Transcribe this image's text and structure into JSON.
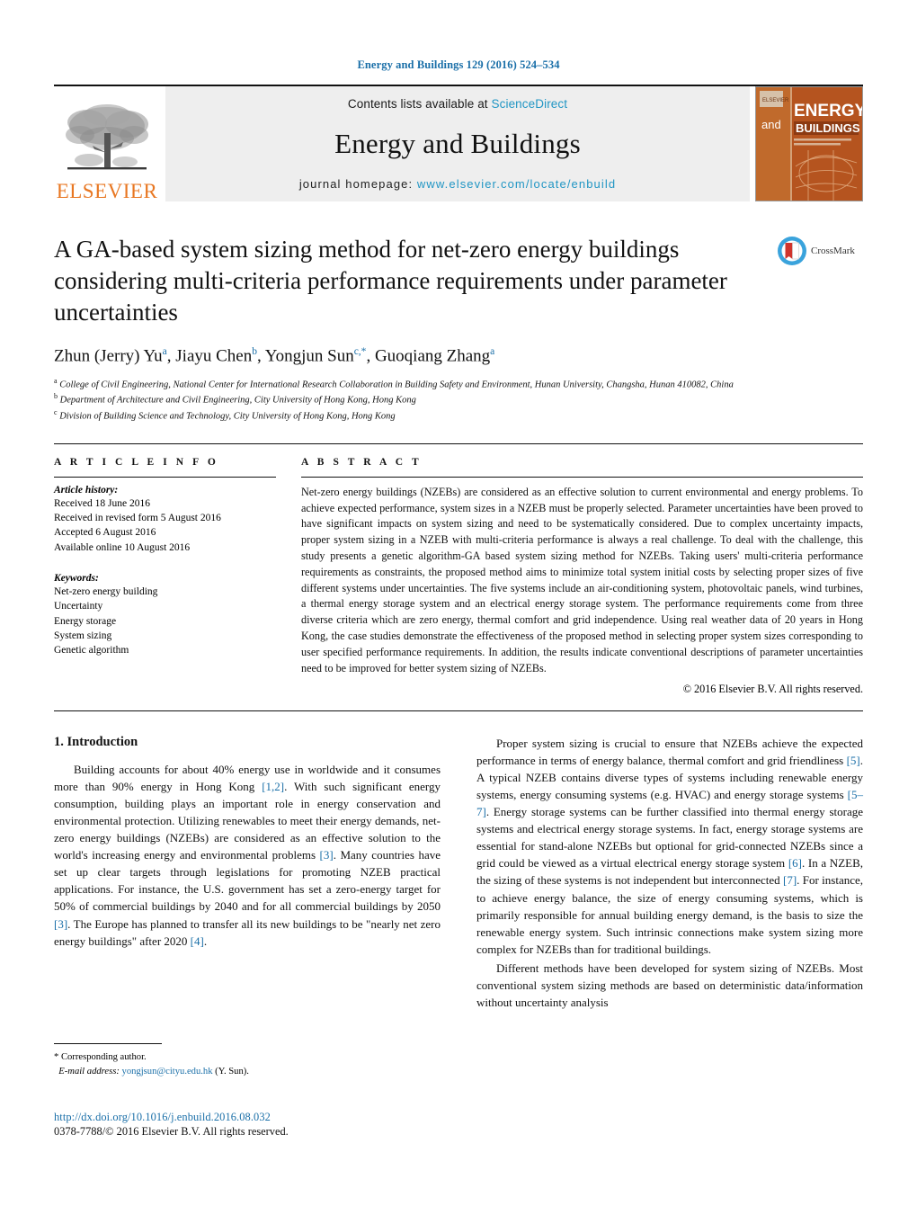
{
  "running_head": "Energy and Buildings 129 (2016) 524–534",
  "masthead": {
    "publisher_name": "ELSEVIER",
    "contents_prefix": "Contents lists available at ",
    "contents_link": "ScienceDirect",
    "journal_name": "Energy and Buildings",
    "homepage_prefix": "journal homepage: ",
    "homepage_url": "www.elsevier.com/locate/enbuild",
    "cover": {
      "line_and": "and",
      "line_energy": "ENERGY",
      "line_buildings": "BUILDINGS"
    }
  },
  "article": {
    "title": "A GA-based system sizing method for net-zero energy buildings considering multi-criteria performance requirements under parameter uncertainties",
    "crossmark_label": "CrossMark",
    "authors_html": "Zhun (Jerry) Yu<sup>a</sup>, Jiayu Chen<sup>b</sup>, Yongjun Sun<sup>c,*</sup>, Guoqiang Zhang<sup>a</sup>",
    "affiliations": [
      "a College of Civil Engineering, National Center for International Research Collaboration in Building Safety and Environment, Hunan University, Changsha, Hunan 410082, China",
      "b Department of Architecture and Civil Engineering, City University of Hong Kong, Hong Kong",
      "c Division of Building Science and Technology, City University of Hong Kong, Hong Kong"
    ]
  },
  "info": {
    "heading": "A R T I C L E   I N F O",
    "history_label": "Article history:",
    "history": [
      "Received 18 June 2016",
      "Received in revised form 5 August 2016",
      "Accepted 6 August 2016",
      "Available online 10 August 2016"
    ],
    "keywords_label": "Keywords:",
    "keywords": [
      "Net-zero energy building",
      "Uncertainty",
      "Energy storage",
      "System sizing",
      "Genetic algorithm"
    ]
  },
  "abstract": {
    "heading": "A B S T R A C T",
    "text": "Net-zero energy buildings (NZEBs) are considered as an effective solution to current environmental and energy problems. To achieve expected performance, system sizes in a NZEB must be properly selected. Parameter uncertainties have been proved to have significant impacts on system sizing and need to be systematically considered. Due to complex uncertainty impacts, proper system sizing in a NZEB with multi-criteria performance is always a real challenge. To deal with the challenge, this study presents a genetic algorithm-GA based system sizing method for NZEBs. Taking users' multi-criteria performance requirements as constraints, the proposed method aims to minimize total system initial costs by selecting proper sizes of five different systems under uncertainties. The five systems include an air-conditioning system, photovoltaic panels, wind turbines, a thermal energy storage system and an electrical energy storage system. The performance requirements come from three diverse criteria which are zero energy, thermal comfort and grid independence. Using real weather data of 20 years in Hong Kong, the case studies demonstrate the effectiveness of the proposed method in selecting proper system sizes corresponding to user specified performance requirements. In addition, the results indicate conventional descriptions of parameter uncertainties need to be improved for better system sizing of NZEBs.",
    "copyright": "© 2016 Elsevier B.V. All rights reserved."
  },
  "introduction": {
    "section_title": "1.  Introduction",
    "left_paragraphs": [
      "Building accounts for about 40% energy use in worldwide and it consumes more than 90% energy in Hong Kong [1,2]. With such significant energy consumption, building plays an important role in energy conservation and environmental protection. Utilizing renewables to meet their energy demands, net-zero energy buildings (NZEBs) are considered as an effective solution to the world's increasing energy and environmental problems [3]. Many countries have set up clear targets through legislations for promoting NZEB practical applications. For instance, the U.S. government has set a zero-energy target for 50% of commercial buildings by 2040 and for all commercial buildings by 2050 [3]. The Europe has planned to transfer all its new buildings to be \"nearly net zero energy buildings\" after 2020 [4]."
    ],
    "right_paragraphs": [
      "Proper system sizing is crucial to ensure that NZEBs achieve the expected performance in terms of energy balance, thermal comfort and grid friendliness [5]. A typical NZEB contains diverse types of systems including renewable energy systems, energy consuming systems (e.g. HVAC) and energy storage systems [5–7]. Energy storage systems can be further classified into thermal energy storage systems and electrical energy storage systems. In fact, energy storage systems are essential for stand-alone NZEBs but optional for grid-connected NZEBs since a grid could be viewed as a virtual electrical energy storage system [6]. In a NZEB, the sizing of these systems is not independent but interconnected [7]. For instance, to achieve energy balance, the size of energy consuming systems, which is primarily responsible for annual building energy demand, is the basis to size the renewable energy system. Such intrinsic connections make system sizing more complex for NZEBs than for traditional buildings.",
      "Different methods have been developed for system sizing of NZEBs. Most conventional system sizing methods are based on deterministic data/information without uncertainty analysis"
    ]
  },
  "footnotes": {
    "corresponding_author": "* Corresponding author.",
    "email_label": "E-mail address:",
    "email": "yongjsun@cityu.edu.hk",
    "email_suffix": "(Y. Sun).",
    "doi": "http://dx.doi.org/10.1016/j.enbuild.2016.08.032",
    "issn_line": "0378-7788/© 2016 Elsevier B.V. All rights reserved."
  },
  "colors": {
    "link_blue": "#1a6fa8",
    "sciencedirect_blue": "#2196c4",
    "elsevier_orange": "#e87722",
    "cover_orange": "#b5541f"
  }
}
